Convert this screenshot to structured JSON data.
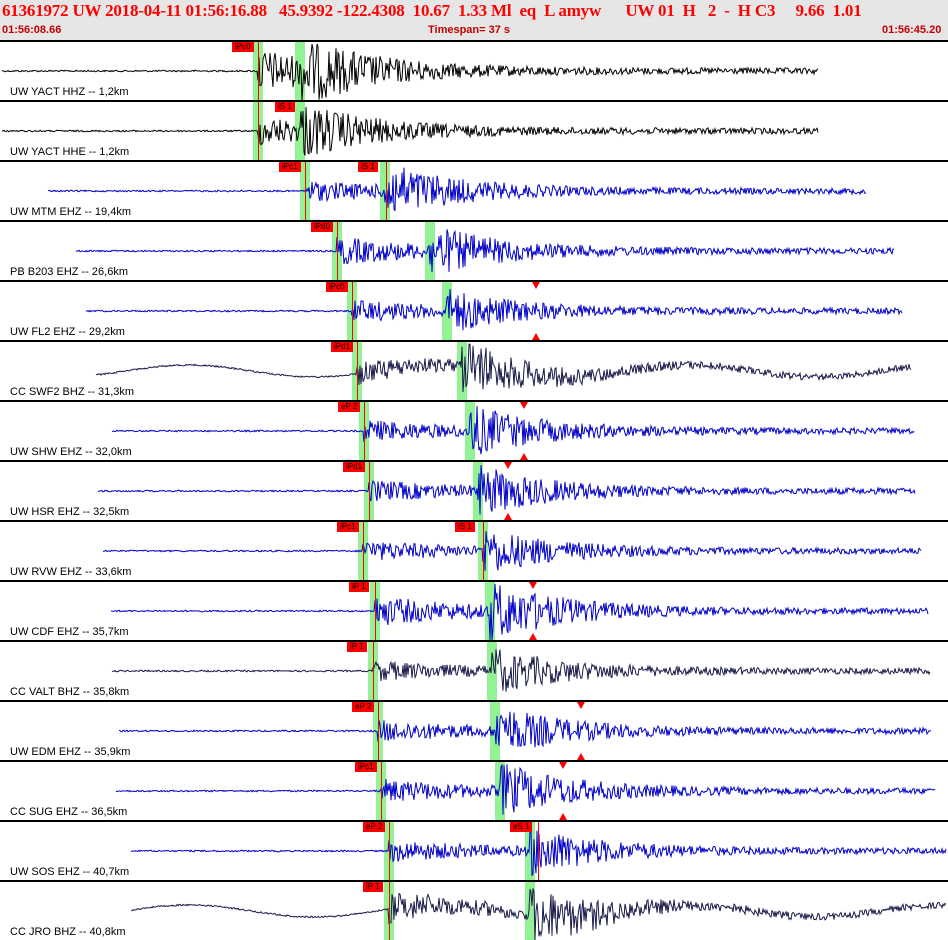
{
  "header": {
    "title": "61361972 UW 2018-04-11 01:56:16.88   45.9392 -122.4308  10.67  1.33 Ml  eq  L amyw      UW 01  H   2  -  H C3     9.66  1.01",
    "start_time": "01:56:08.66",
    "timespan": "Timespan=  37 s",
    "end_time": "01:56:45.20"
  },
  "colors": {
    "header_text": "#ff0000",
    "pick": "#ff0000",
    "window": "#80f080",
    "trace_blue": "#0000cc",
    "trace_black": "#000000",
    "trace_navy": "#1a1a4a"
  },
  "traces": [
    {
      "label": "UW YACT HHZ -- 1,2km",
      "pick": "iPc0",
      "color": "#000000"
    },
    {
      "label": "UW YACT HHE -- 1,2km",
      "pick": "iS 1",
      "color": "#000000"
    },
    {
      "label": "UW MTM EHZ -- 19,4km",
      "pick": "iPc1",
      "pick2": "iS 1",
      "color": "#0000cc"
    },
    {
      "label": "PB B203 EHZ -- 26,6km",
      "pick": "iPd0",
      "color": "#0000cc"
    },
    {
      "label": "UW FL2 EHZ -- 29,2km",
      "pick": "iPc0",
      "color": "#0000cc"
    },
    {
      "label": "CC SWF2 BHZ -- 31,3km",
      "pick": "iPd1",
      "color": "#1a1a4a"
    },
    {
      "label": "UW SHW EHZ -- 32,0km",
      "pick": "eP 2",
      "color": "#0000cc"
    },
    {
      "label": "UW HSR EHZ -- 32,5km",
      "pick": "iPd1",
      "color": "#0000cc"
    },
    {
      "label": "UW RVW EHZ -- 33,6km",
      "pick": "iPc1",
      "pick2": "iS 1",
      "color": "#0000cc"
    },
    {
      "label": "UW CDF EHZ -- 35,7km",
      "pick": "iP 1",
      "color": "#0000cc"
    },
    {
      "label": "CC VALT BHZ -- 35,8km",
      "pick": "iP 1",
      "color": "#1a1a4a"
    },
    {
      "label": "UW EDM EHZ -- 35,9km",
      "pick": "eP 2",
      "color": "#0000cc"
    },
    {
      "label": "CC SUG EHZ -- 36,5km",
      "pick": "iPc1",
      "color": "#0000cc"
    },
    {
      "label": "UW SOS EHZ -- 40,7km",
      "pick": "eP 2",
      "pick2": "eS 1",
      "color": "#0000cc"
    },
    {
      "label": "CC JRO BHZ -- 40,8km",
      "pick": "iP 1",
      "color": "#1a1a4a"
    }
  ]
}
